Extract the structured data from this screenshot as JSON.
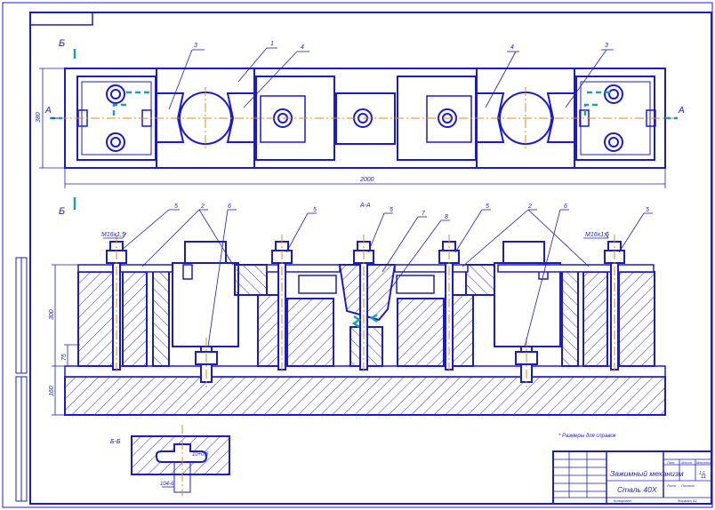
{
  "title_block": {
    "name": "Зажимный механизм",
    "material": "Сталь 40Х",
    "sheet_total": "11",
    "scale": "1:1",
    "sheet_label": "Лист",
    "sheets_label": "Листов",
    "rev_label": "Лит.",
    "mass_label": "Масса",
    "scale_label": "Масштаб",
    "bottom_left": "Копировал",
    "bottom_right": "Формат А1"
  },
  "plan_view": {
    "section_marker_b": "Б",
    "section_marker_a": "А",
    "dim_total": "2000",
    "dim_height": "380",
    "leaders": [
      "3",
      "1",
      "4",
      "4",
      "3"
    ]
  },
  "section_view": {
    "label": "А-А",
    "marker_b": "Б",
    "thread_left": "М16х1,5",
    "thread_right": "М16х1,5",
    "dim_height": "300",
    "dim_base": "160",
    "dim_lower": "75",
    "leaders": [
      "5",
      "2",
      "6",
      "5",
      "5",
      "7",
      "8",
      "5",
      "2",
      "6",
      "5"
    ]
  },
  "detail_view": {
    "label": "Б-Б",
    "dim_slot": "10+0,5",
    "dim_width": "104-6",
    "note": "* Размеры для справок"
  },
  "colors": {
    "outline": "#1a1ad6",
    "centerline": "#e08a1e",
    "cyan": "#1aa0b0",
    "hatch": "#2a2ad0"
  }
}
